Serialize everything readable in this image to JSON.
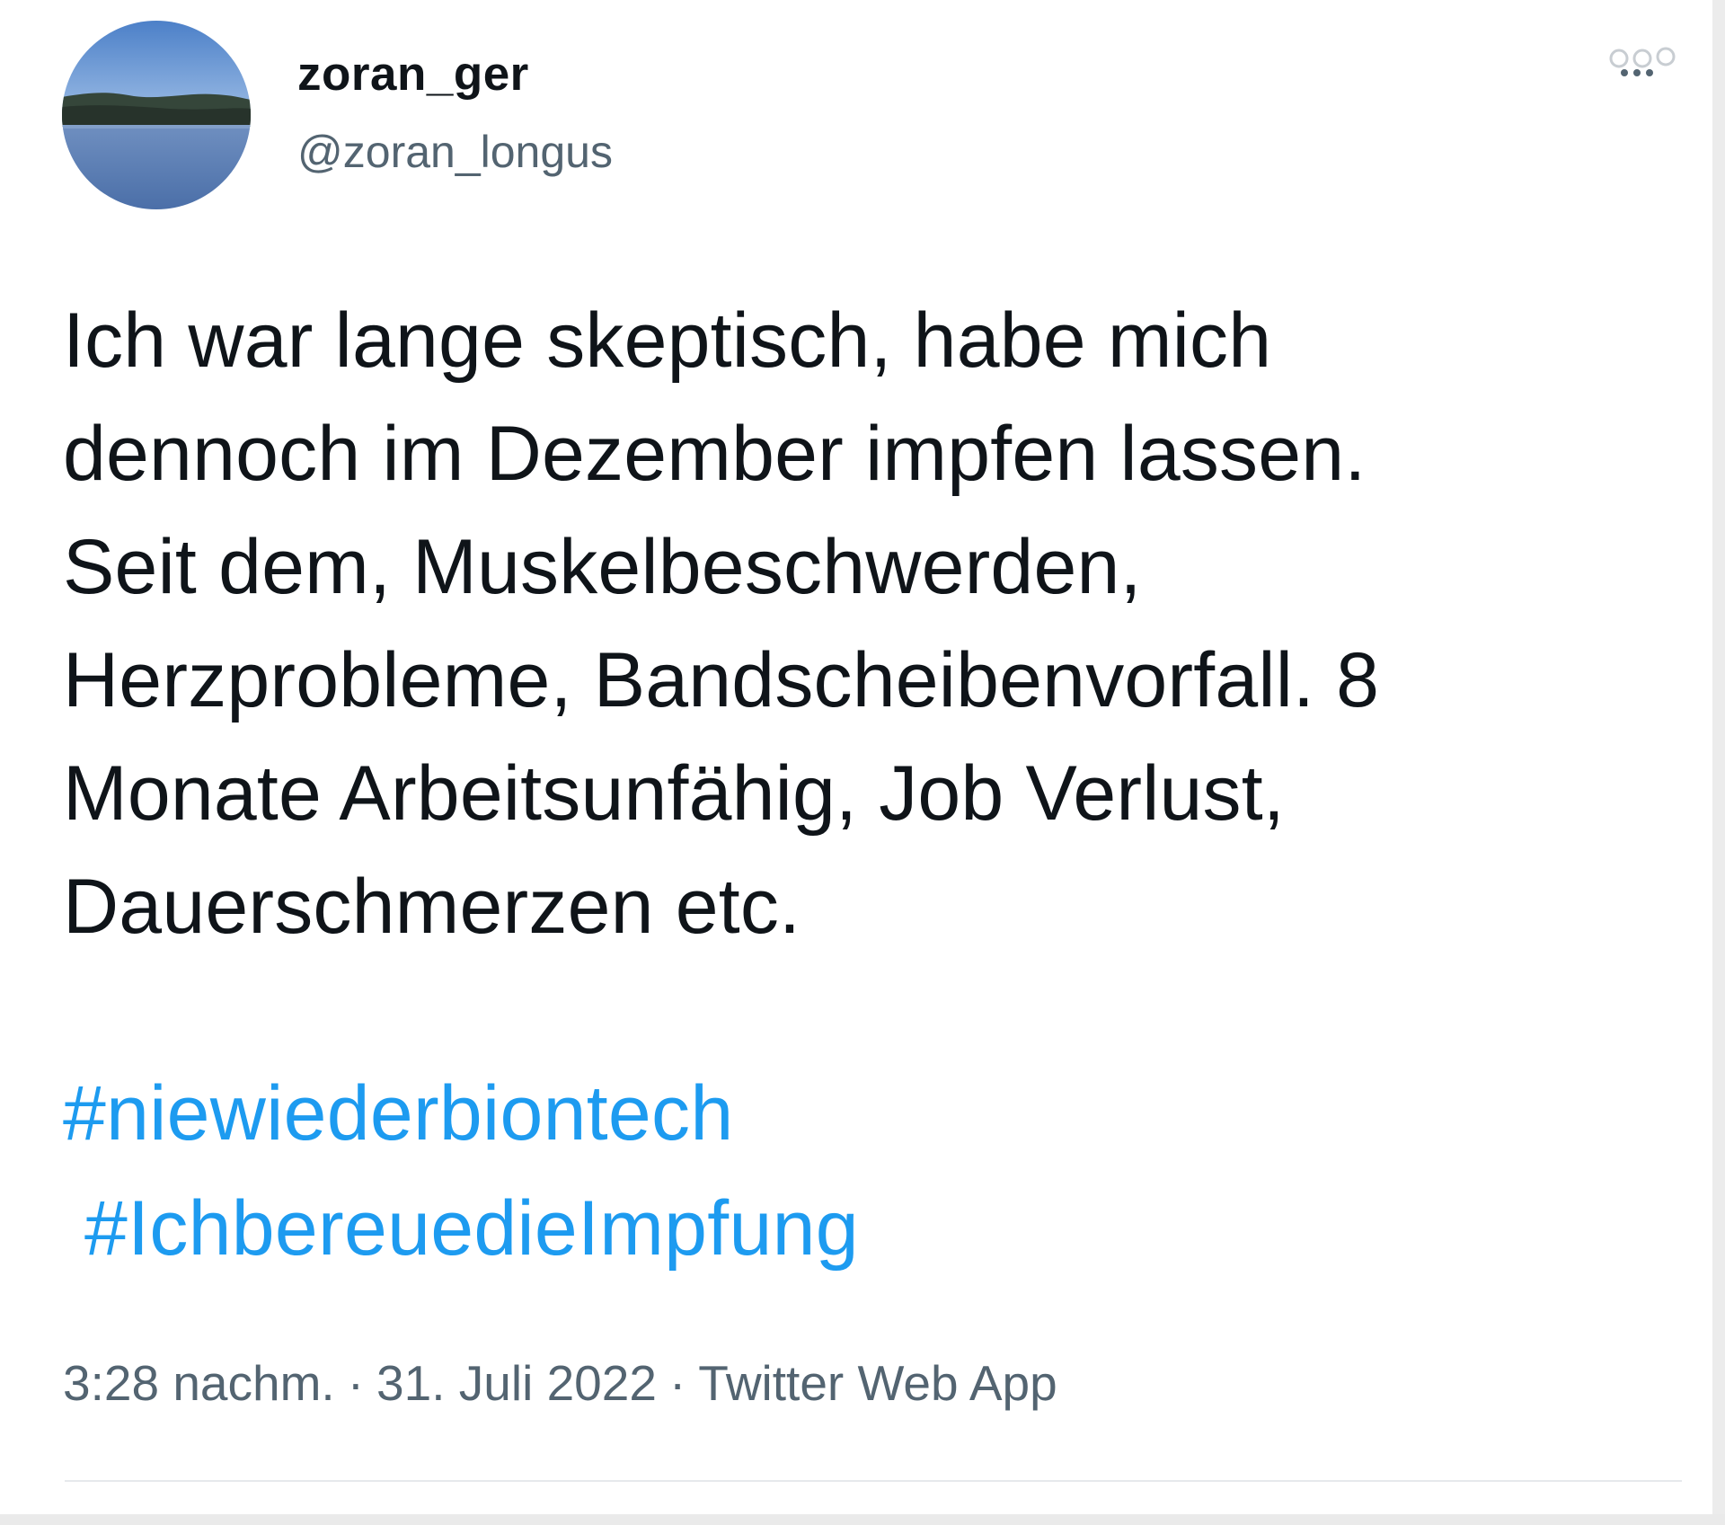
{
  "tweet": {
    "author": {
      "display_name": "zoran_ger",
      "handle": "@zoran_longus",
      "avatar_icon": "lake-landscape-avatar"
    },
    "more_icon": "more-options-icon",
    "text_lines": [
      "Ich war lange skeptisch, habe mich",
      "dennoch im Dezember impfen lassen.",
      "Seit dem, Muskelbeschwerden,",
      "Herzprobleme, Bandscheibenvorfall. 8",
      "Monate Arbeitsunfähig, Job Verlust,",
      "Dauerschmerzen etc."
    ],
    "hashtags": [
      "#niewiederbiontech",
      "#IchbereuedieImpfung"
    ],
    "meta": {
      "time": "3:28 nachm.",
      "separator": "·",
      "date": "31. Juli 2022",
      "source": "Twitter Web App"
    }
  },
  "colors": {
    "text": "#0f1419",
    "secondary": "#536471",
    "link": "#1d9bf0"
  }
}
